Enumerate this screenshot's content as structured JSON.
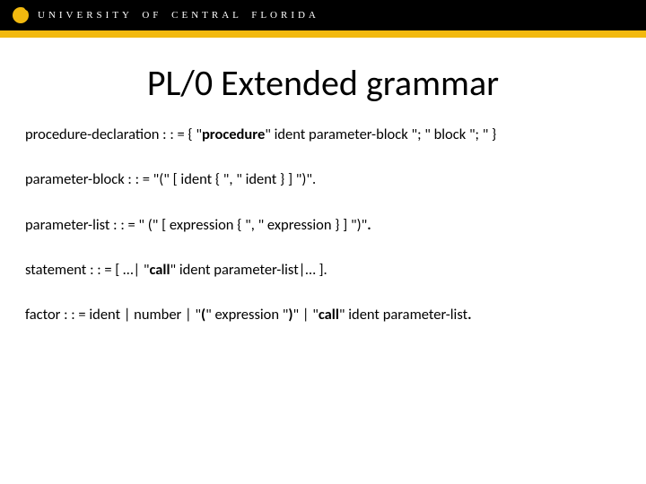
{
  "header": {
    "university": "UNIVERSITY OF CENTRAL FLORIDA"
  },
  "title": "PL/0 Extended grammar",
  "rules": {
    "r1": {
      "lhs": "procedure-declaration : : =  { \"",
      "kw": "procedure",
      "rhs": "\" ident parameter-block \"; \" block \"; \" }"
    },
    "r2": "parameter-block : : = \"(\" [ ident { \", \" ident } ] \")\".",
    "r3": {
      "a": "parameter-list : : = \" (\" [ expression { \", \" expression } ] \")\"",
      "b": "."
    },
    "r4": {
      "a": "statement   : : = [ …| \"",
      "kw": "call",
      "b": "\" ident parameter-list|… ]."
    },
    "r5": {
      "a": "factor : : = ident | number | \"",
      "kw1": "(",
      "b": "\" expression \"",
      "kw2": ")",
      "c": "\" | \"",
      "kw3": "call",
      "d": "\" ident parameter-list",
      "e": "."
    }
  }
}
